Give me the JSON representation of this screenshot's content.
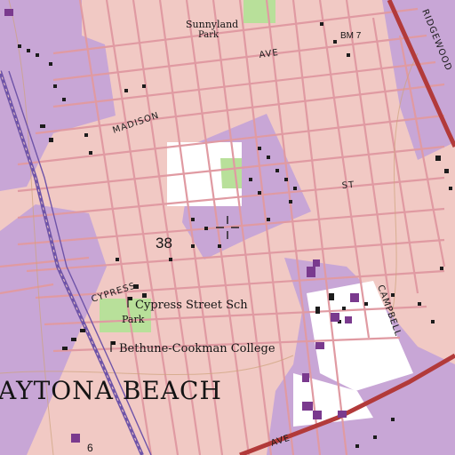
{
  "map": {
    "place_labels": {
      "city": "AYTONA BEACH",
      "school": "Cypress Street Sch",
      "college": "Bethune-Cookman College",
      "park_small": "Park",
      "park_north_line1": "Sunnyland",
      "park_north_line2": "Park"
    },
    "street_labels": {
      "madison": "MADISON",
      "ave_north": "AVE",
      "cypress": "CYPRESS",
      "st_east": "ST",
      "campbell": "CAMPBELL",
      "ridgewood": "RIDGEWOOD",
      "ave_south": "AVE"
    },
    "other_labels": {
      "benchmark": "BM 7",
      "route_number": "38",
      "route_small": "6"
    },
    "colors": {
      "urban_tint": "#f1c9c4",
      "residential_purple": "#c8a6d6",
      "street_pink": "#e09aa2",
      "major_road_red": "#b23a3a",
      "railway": "#6f54a8",
      "park_green": "#b8e09a",
      "open_white": "#ffffff",
      "building_black": "#1c1c1c",
      "building_purple": "#7a3a8e",
      "contour_brown": "#cda37c"
    },
    "marker": "target-crosshair-icon"
  }
}
